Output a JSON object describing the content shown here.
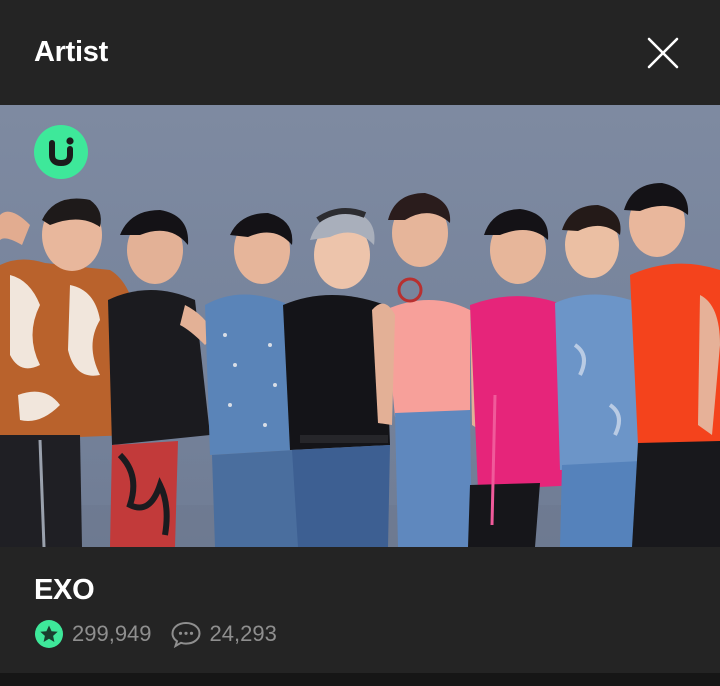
{
  "header": {
    "title": "Artist"
  },
  "artist": {
    "name": "EXO",
    "favorites": "299,949",
    "comments": "24,293"
  },
  "icons": {
    "close": "close-icon",
    "favorites": "star-icon",
    "comments": "speech-bubble-icon",
    "badge": "u-logo-icon"
  },
  "colors": {
    "accent": "#3ee89a",
    "background": "#1d1d1d",
    "panel": "#242424",
    "muted_text": "#8f8f8f"
  }
}
